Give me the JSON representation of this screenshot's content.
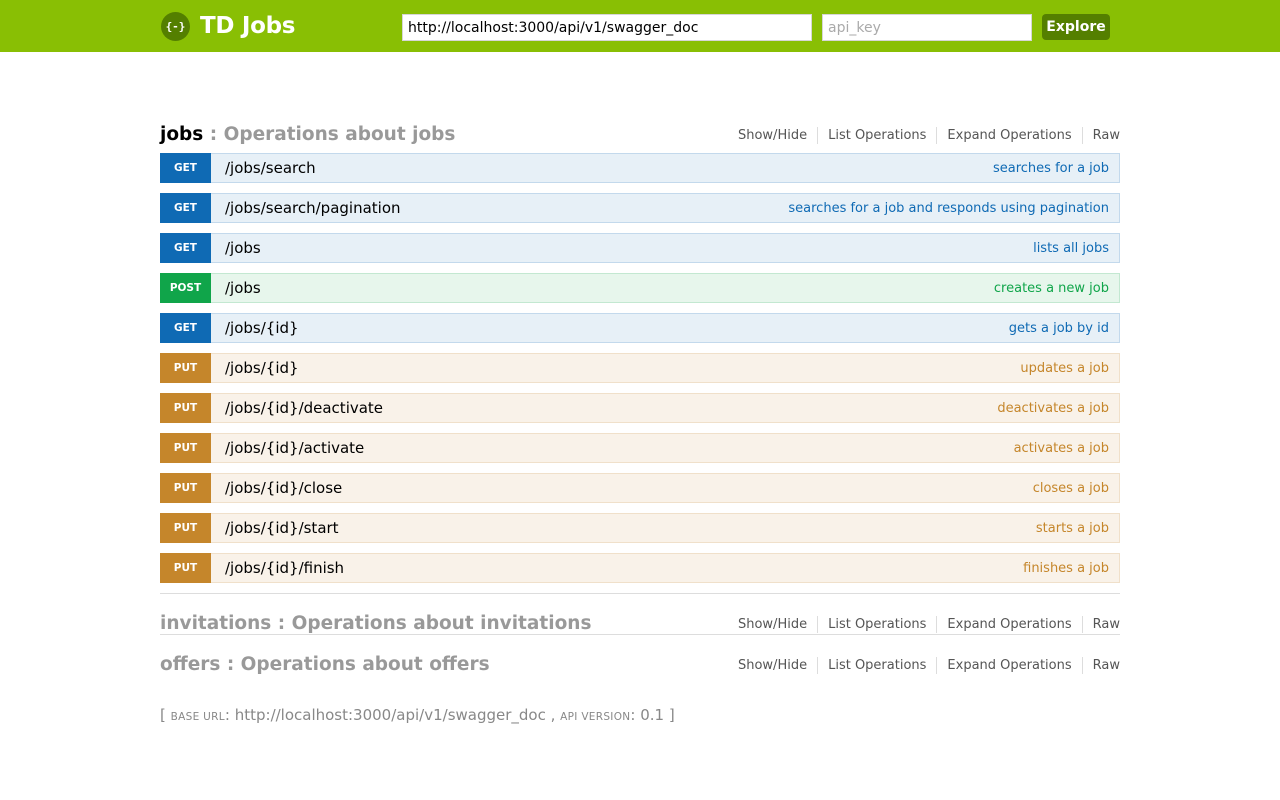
{
  "header": {
    "logo_icon": "{-}",
    "title": "TD Jobs",
    "url_value": "http://localhost:3000/api/v1/swagger_doc",
    "api_key_placeholder": "api_key",
    "explore_label": "Explore",
    "color": "#89bf04"
  },
  "resource_actions": {
    "show_hide": "Show/Hide",
    "list_operations": "List Operations",
    "expand_operations": "Expand Operations",
    "raw": "Raw"
  },
  "resources": [
    {
      "name": "jobs",
      "separator": " : ",
      "description": "Operations about jobs"
    },
    {
      "name": "invitations",
      "separator": " : ",
      "description": "Operations about invitations"
    },
    {
      "name": "offers",
      "separator": " : ",
      "description": "Operations about offers"
    }
  ],
  "operations": [
    {
      "method": "GET",
      "path": "/jobs/search",
      "summary": "searches for a job"
    },
    {
      "method": "GET",
      "path": "/jobs/search/pagination",
      "summary": "searches for a job and responds using pagination"
    },
    {
      "method": "GET",
      "path": "/jobs",
      "summary": "lists all jobs"
    },
    {
      "method": "POST",
      "path": "/jobs",
      "summary": "creates a new job"
    },
    {
      "method": "GET",
      "path": "/jobs/{id}",
      "summary": "gets a job by id"
    },
    {
      "method": "PUT",
      "path": "/jobs/{id}",
      "summary": "updates a job"
    },
    {
      "method": "PUT",
      "path": "/jobs/{id}/deactivate",
      "summary": "deactivates a job"
    },
    {
      "method": "PUT",
      "path": "/jobs/{id}/activate",
      "summary": "activates a job"
    },
    {
      "method": "PUT",
      "path": "/jobs/{id}/close",
      "summary": "closes a job"
    },
    {
      "method": "PUT",
      "path": "/jobs/{id}/start",
      "summary": "starts a job"
    },
    {
      "method": "PUT",
      "path": "/jobs/{id}/finish",
      "summary": "finishes a job"
    }
  ],
  "method_colors": {
    "GET": "#0f6ab4",
    "POST": "#10a54a",
    "PUT": "#c5862b"
  },
  "footer": {
    "open": "[ ",
    "base_url_label": "base url",
    "colon": ": ",
    "base_url": "http://localhost:3000/api/v1/swagger_doc",
    "comma": " , ",
    "api_version_label": "api version",
    "api_version": "0.1",
    "close": " ]"
  }
}
